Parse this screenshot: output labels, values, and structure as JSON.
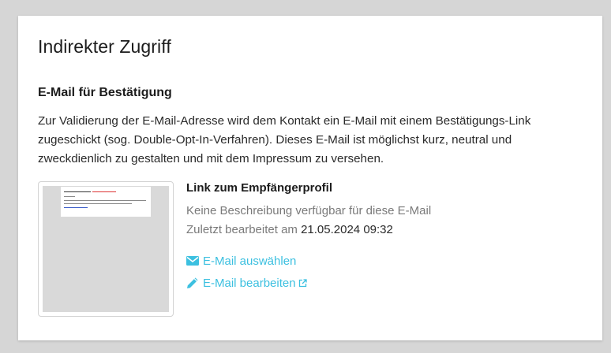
{
  "page": {
    "title": "Indirekter Zugriff"
  },
  "section": {
    "title": "E-Mail für Bestätigung",
    "description": "Zur Validierung der E-Mail-Adresse wird dem Kontakt ein E-Mail mit einem Bestätigungs-Link zugeschickt (sog. Double-Opt-In-Verfahren). Dieses E-Mail ist möglichst kurz, neutral und zweckdienlich zu gestalten und mit dem Impressum zu versehen."
  },
  "email": {
    "name": "Link zum Empfängerprofil",
    "description": "Keine Beschreibung verfügbar für diese E-Mail",
    "edited_label": "Zuletzt bearbeitet am",
    "edited_date": "21.05.2024 09:32",
    "select_label": "E-Mail auswählen",
    "edit_label": "E-Mail bearbeiten",
    "select_icon": "envelope-icon",
    "edit_icon": "pencil-icon",
    "external_icon": "external-link-icon"
  },
  "colors": {
    "link": "#3cc0e0",
    "muted": "#7a7a7a",
    "background": "#d6d6d6",
    "thumb_bg": "#d9d9d9"
  }
}
